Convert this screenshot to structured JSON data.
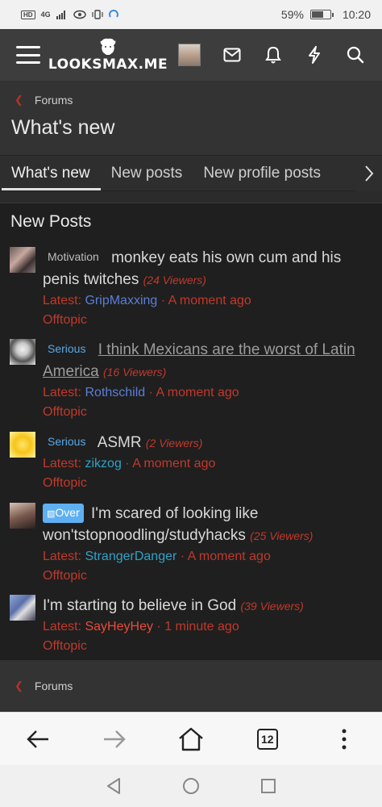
{
  "status": {
    "network_badge": "HD",
    "network_type": "4G",
    "battery": "59%",
    "battery_level": 0.59,
    "time": "10:20"
  },
  "header": {
    "logo_text": "LOOKSMAX.ME",
    "icons": [
      "menu-icon",
      "logo-icon",
      "avatar",
      "inbox-icon",
      "bell-icon",
      "lightning-icon",
      "search-icon"
    ]
  },
  "breadcrumb": {
    "label": "Forums"
  },
  "page": {
    "title": "What's new"
  },
  "tabs": [
    {
      "label": "What's new",
      "active": true
    },
    {
      "label": "New posts",
      "active": false
    },
    {
      "label": "New profile posts",
      "active": false
    }
  ],
  "section": {
    "title": "New Posts"
  },
  "posts": [
    {
      "prefix": "Motivation",
      "title": "monkey eats his own cum and his penis twitches",
      "viewers": "(24 Viewers)",
      "latest_label": "Latest:",
      "user": "GripMaxxing",
      "sep": "·",
      "time": "A moment ago",
      "forum": "Offtopic"
    },
    {
      "prefix": "Serious",
      "title": "I think Mexicans are the worst of Latin America",
      "viewers": "(16 Viewers)",
      "latest_label": "Latest:",
      "user": "Rothschild",
      "sep": "·",
      "time": "A moment ago",
      "forum": "Offtopic"
    },
    {
      "prefix": "Serious",
      "title": "ASMR",
      "viewers": "(2 Viewers)",
      "latest_label": "Latest:",
      "user": "zikzog",
      "sep": "·",
      "time": "A moment ago",
      "forum": "Offtopic"
    },
    {
      "prefix": "Over",
      "title": "I'm scared of looking like won'tstopnoodling/studyhacks",
      "viewers": "(25 Viewers)",
      "latest_label": "Latest:",
      "user": "StrangerDanger",
      "sep": "·",
      "time": "A moment ago",
      "forum": "Offtopic"
    },
    {
      "prefix": "",
      "title": "I'm starting to believe in God",
      "viewers": "(39 Viewers)",
      "latest_label": "Latest:",
      "user": "SayHeyHey",
      "sep": "·",
      "time": "1 minute ago",
      "forum": "Offtopic"
    }
  ],
  "footer": {
    "breadcrumb_label": "Forums"
  },
  "browser": {
    "tab_count": "12"
  },
  "colors": {
    "accent_red": "#c0392b",
    "link_blue": "#5a7ed6",
    "link_cyan": "#2ea3c7",
    "prefix_blue": "#59a7e6",
    "header_bg": "#3d3d3d",
    "body_bg": "#1f1f1f"
  }
}
